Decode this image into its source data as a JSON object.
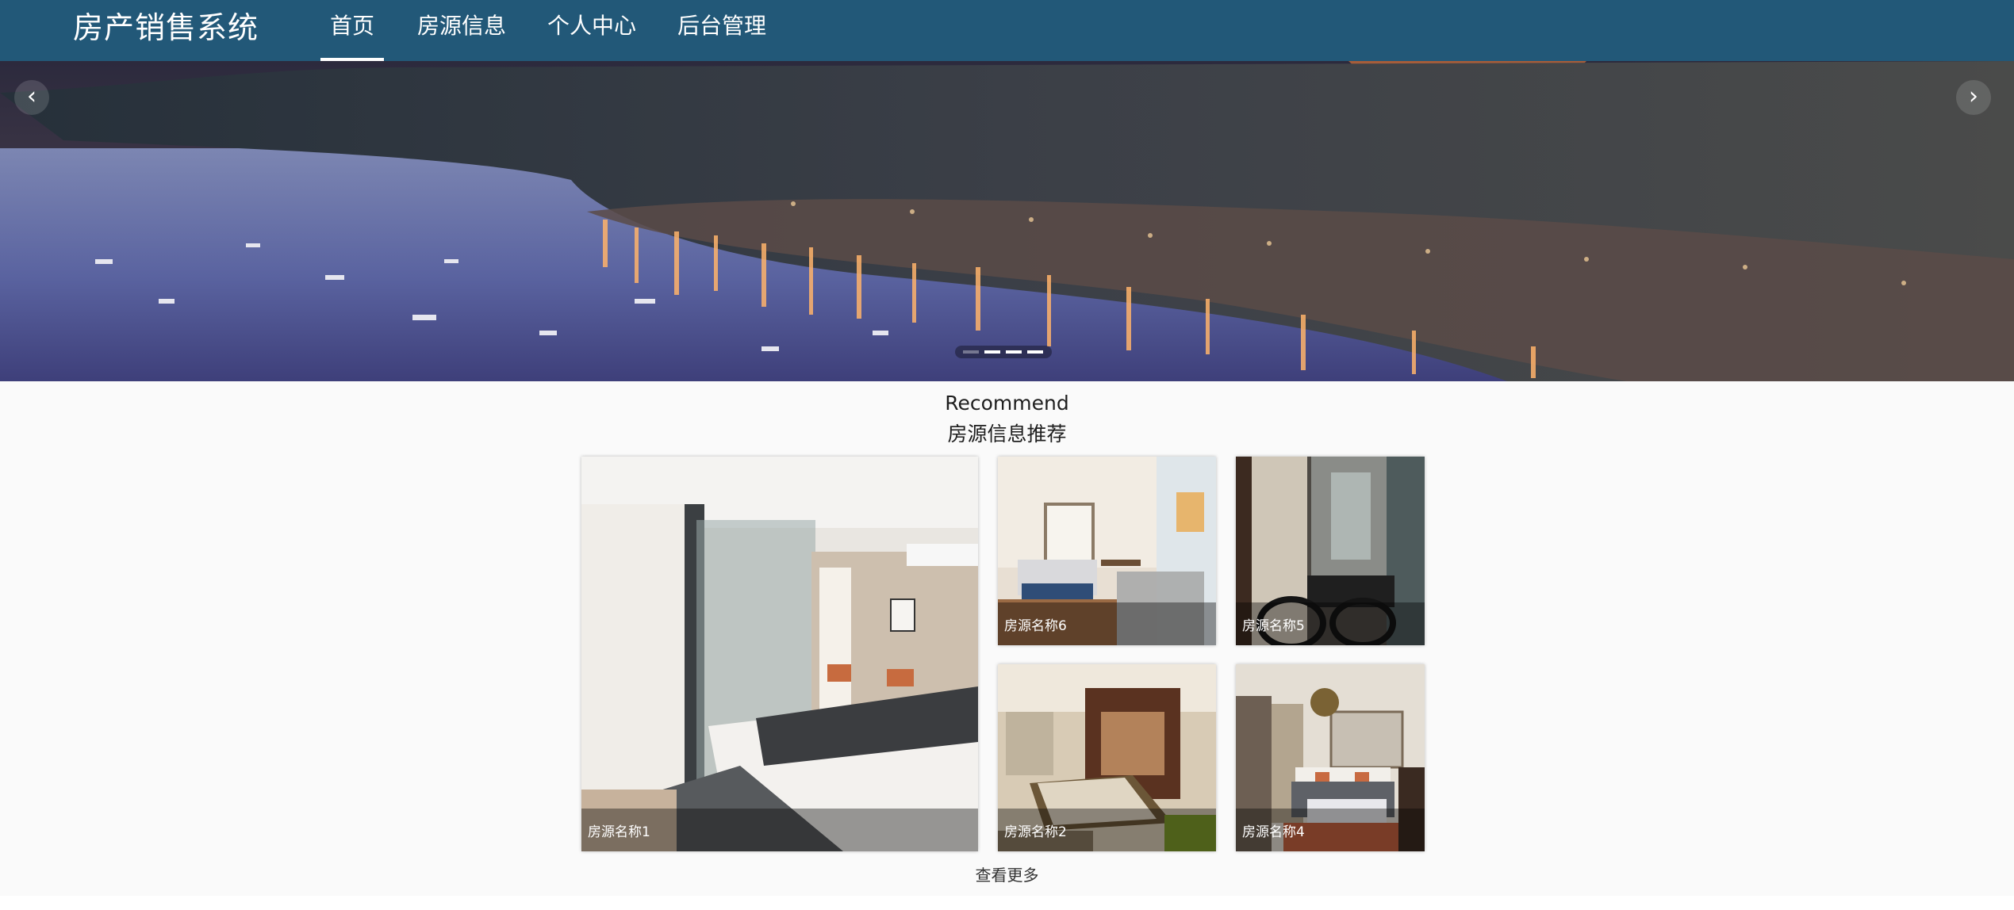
{
  "header": {
    "brand": "房产销售系统",
    "nav": [
      {
        "label": "首页",
        "active": true
      },
      {
        "label": "房源信息",
        "active": false
      },
      {
        "label": "个人中心",
        "active": false
      },
      {
        "label": "后台管理",
        "active": false
      }
    ]
  },
  "carousel": {
    "prev_icon": "chevron-left-icon",
    "next_icon": "chevron-right-icon",
    "prev_glyph": "‹",
    "next_glyph": "›",
    "slide_count": 4,
    "active_index": 0
  },
  "recommend": {
    "title_en": "Recommend",
    "title_cn": "房源信息推荐",
    "items": [
      {
        "name": "房源名称1"
      },
      {
        "name": "房源名称6"
      },
      {
        "name": "房源名称5"
      },
      {
        "name": "房源名称2"
      },
      {
        "name": "房源名称4"
      }
    ],
    "more_label": "查看更多"
  },
  "colors": {
    "navbar": "#225878",
    "page_bg": "#fafafa",
    "caption_overlay": "rgba(0,0,0,0.38)"
  }
}
